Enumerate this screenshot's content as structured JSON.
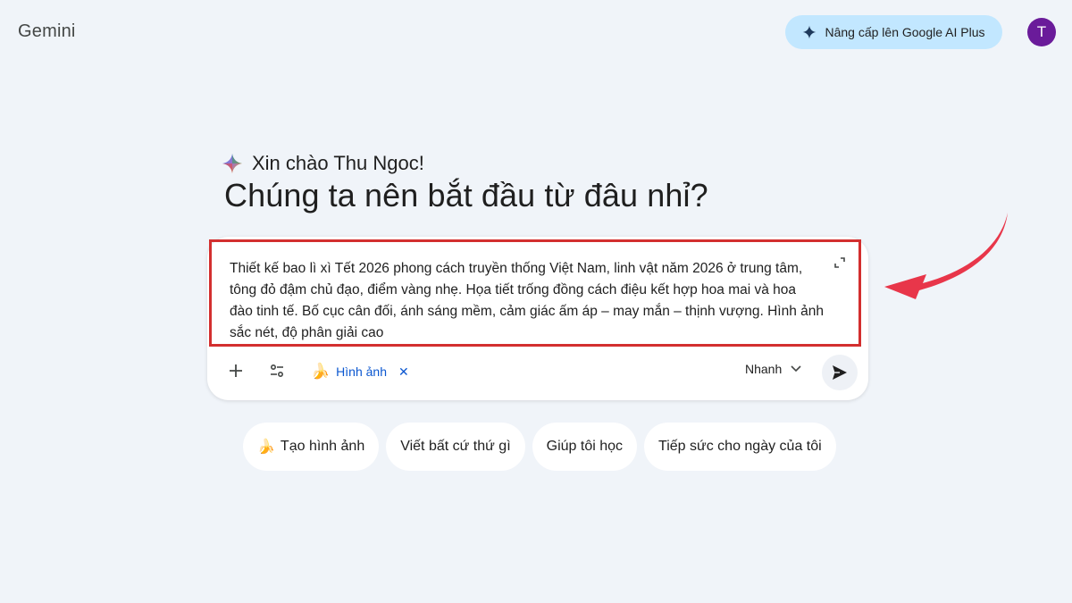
{
  "app": {
    "title": "Gemini"
  },
  "header": {
    "upgrade_label": "Nâng cấp lên Google AI Plus",
    "avatar_initial": "T"
  },
  "hero": {
    "greeting": "Xin chào Thu Ngoc!",
    "headline": "Chúng ta nên bắt đầu từ đâu nhỉ?"
  },
  "composer": {
    "prompt_text": "Thiết kế bao lì xì Tết 2026 phong cách truyền thống Việt Nam, linh vật năm 2026 ở trung tâm,\ntông đỏ đậm chủ đạo, điểm vàng nhẹ. Họa tiết trống đồng cách điệu kết hợp hoa mai và hoa\nđào tinh tế. Bố cục cân đối, ánh sáng mềm, cảm giác ấm áp – may mắn – thịnh vượng. Hình ảnh\nsắc nét, độ phân giải cao",
    "image_chip_label": "Hình ảnh",
    "mode_label": "Nhanh"
  },
  "suggestions": [
    {
      "label": "Tạo hình ảnh",
      "icon": "banana-icon"
    },
    {
      "label": "Viết bất cứ thứ gì"
    },
    {
      "label": "Giúp tôi học"
    },
    {
      "label": "Tiếp sức cho ngày của tôi"
    }
  ],
  "colors": {
    "background": "#f0f4f9",
    "upgrade_bg": "#c2e7ff",
    "avatar_bg": "#6a1b9a",
    "highlight_border": "#d32f2f",
    "arrow": "#e8364a",
    "chip_text": "#0b57d0"
  }
}
